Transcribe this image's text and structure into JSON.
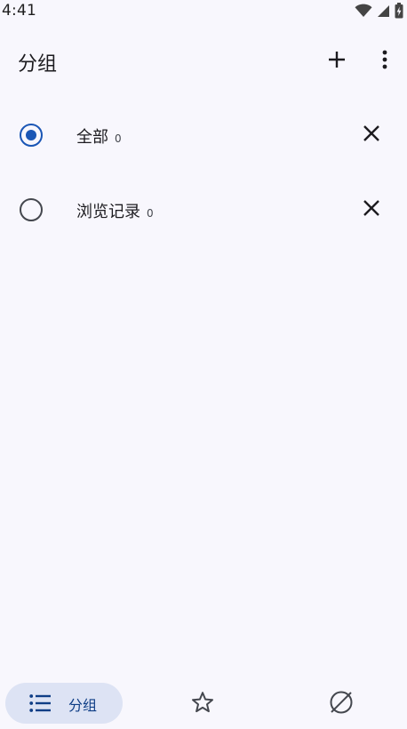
{
  "status_bar": {
    "time": "4:41",
    "icons": [
      "wifi-icon",
      "cell-signal-icon",
      "battery-charging-icon"
    ]
  },
  "app_bar": {
    "title": "分组",
    "actions": [
      "add-icon",
      "more-vertical-icon"
    ]
  },
  "groups": [
    {
      "name": "全部",
      "count": "0",
      "selected": true
    },
    {
      "name": "浏览记录",
      "count": "0",
      "selected": false
    }
  ],
  "bottom_nav": {
    "items": [
      {
        "label": "分组",
        "icon": "list-icon",
        "active": true
      },
      {
        "label": "",
        "icon": "star-icon",
        "active": false
      },
      {
        "label": "",
        "icon": "explore-off-icon",
        "active": false
      }
    ]
  },
  "colors": {
    "background": "#f8f7fd",
    "accent": "#1a56b5",
    "nav_active_bg": "#dde3f4",
    "nav_active_text": "#0f3e86",
    "text_primary": "#1c1b1f",
    "text_secondary": "#44474e"
  }
}
